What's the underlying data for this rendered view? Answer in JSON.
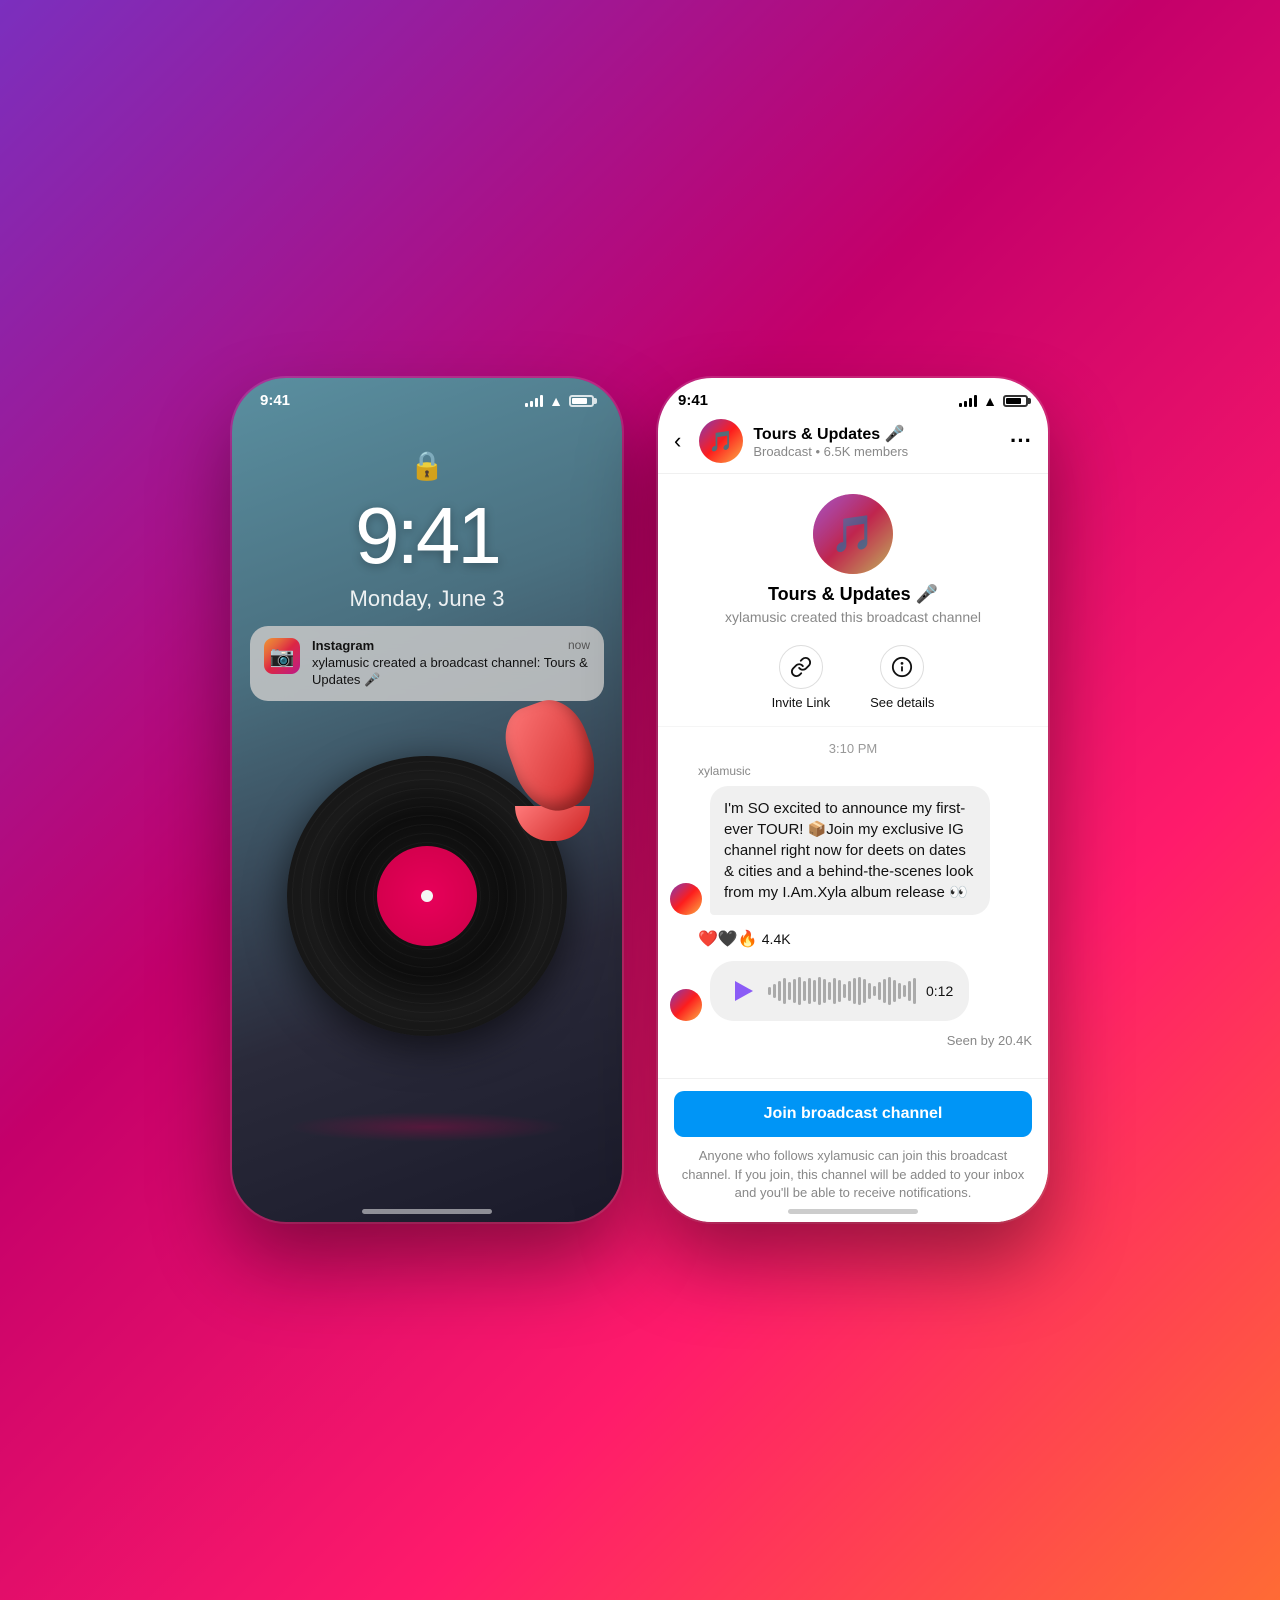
{
  "left_phone": {
    "status_bar": {
      "time": "9:41"
    },
    "lock": {
      "time": "9:41",
      "date": "Monday, June 3"
    },
    "notification": {
      "app": "Instagram",
      "time_label": "now",
      "text": "xylamusic created a broadcast channel: Tours & Updates 🎤"
    }
  },
  "right_phone": {
    "status_bar": {
      "time": "9:41"
    },
    "header": {
      "channel_name": "Tours & Updates 🎤",
      "channel_meta": "Broadcast • 6.5K members"
    },
    "channel_info": {
      "full_name": "Tours & Updates 🎤",
      "created_by": "xylamusic created this broadcast channel"
    },
    "actions": [
      {
        "label": "Invite Link",
        "icon": "🔗"
      },
      {
        "label": "See details",
        "icon": "ℹ️"
      }
    ],
    "time_divider": "3:10 PM",
    "message_sender": "xylamusic",
    "message_text": "I'm SO excited to announce my first-ever TOUR! 📦Join my exclusive IG channel right now for deets on dates & cities and a behind-the-scenes look from my I.Am.Xyla album release 👀",
    "reactions": "❤️🖤🔥 4.4K",
    "voice_message": {
      "duration": "0:12"
    },
    "seen_by": "Seen by 20.4K",
    "join_button": "Join broadcast channel",
    "join_description": "Anyone who follows xylamusic can join this broadcast channel. If you join, this channel will be added to your inbox and you'll be able to receive notifications."
  }
}
